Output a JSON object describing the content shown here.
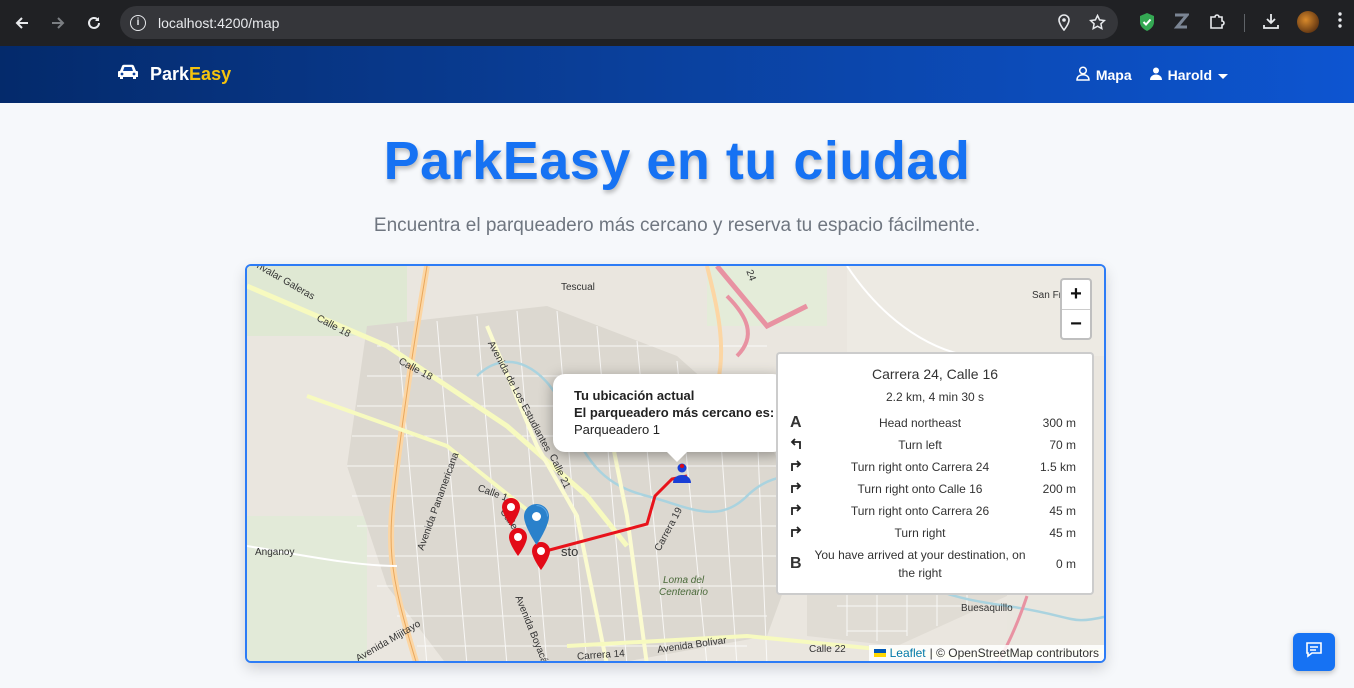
{
  "browser": {
    "url": "localhost:4200/map",
    "icons": [
      "back-icon",
      "forward-icon",
      "reload-icon",
      "info-icon",
      "location-icon",
      "star-icon",
      "shield-extension-icon",
      "z-extension-icon",
      "puzzle-icon",
      "download-icon",
      "avatar",
      "kebab-menu-icon"
    ]
  },
  "navbar": {
    "brand_part1": "Park",
    "brand_part2": "Easy",
    "brand_icon": "car-icon",
    "links": {
      "map": "Mapa",
      "user": "Harold"
    },
    "colors": {
      "brand_accent": "#f4c20d",
      "nav_start": "#042a6b",
      "nav_end": "#0d55d1"
    }
  },
  "hero": {
    "title": "ParkEasy en tu ciudad",
    "subtitle": "Encuentra el parqueadero más cercano y reserva tu espacio fácilmente.",
    "title_color": "#1672f3"
  },
  "map": {
    "zoom_in": "+",
    "zoom_out": "−",
    "labels": {
      "tescual": "Tescual",
      "san_fr": "San Fra",
      "calle18a": "Calle 18",
      "calle18b": "Calle 18",
      "galeras": "nvalar Galeras",
      "estudiantes": "Avenida de Los Estudiantes",
      "panamericana": "Avenida Panamericana",
      "anganoy": "Anganoy",
      "loma": "Loma del",
      "centenario": "Centenario",
      "buesaquillo": "Buesaquillo",
      "mijitayo": "Avenida Mijitayo",
      "boyaca": "Avenida Boyacá",
      "bolivar": "Avenida Bolívar",
      "calle22": "Calle 22",
      "carrera14": "Carrera 14",
      "carrera19": "Carrera 19",
      "calle21": "Calle 21",
      "calle1a": "Calle 1",
      "calle_b": "Calle",
      "pasto": "sto",
      "n24": "24"
    },
    "popup": {
      "line1": "Tu ubicación actual",
      "line2": "El parqueadero más cercano es:",
      "line3": "Parqueadero 1"
    },
    "routing": {
      "title": "Carrera 24, Calle 16",
      "summary": "2.2 km, 4 min 30 s",
      "steps": [
        {
          "icon": "A",
          "text": "Head northeast",
          "distance": "300 m"
        },
        {
          "icon": "turn-left-icon",
          "text": "Turn left",
          "distance": "70 m"
        },
        {
          "icon": "turn-right-icon",
          "text": "Turn right onto Carrera 24",
          "distance": "1.5 km"
        },
        {
          "icon": "turn-right-icon",
          "text": "Turn right onto Calle 16",
          "distance": "200 m"
        },
        {
          "icon": "turn-right-icon",
          "text": "Turn right onto Carrera 26",
          "distance": "45 m"
        },
        {
          "icon": "turn-right-icon",
          "text": "Turn right",
          "distance": "45 m"
        },
        {
          "icon": "B",
          "text": "You have arrived at your destination, on the right",
          "distance": "0 m"
        }
      ]
    },
    "attribution": {
      "leaflet": "Leaflet",
      "rest": "| © OpenStreetMap contributors"
    }
  },
  "chat": {
    "icon": "chat-icon"
  }
}
